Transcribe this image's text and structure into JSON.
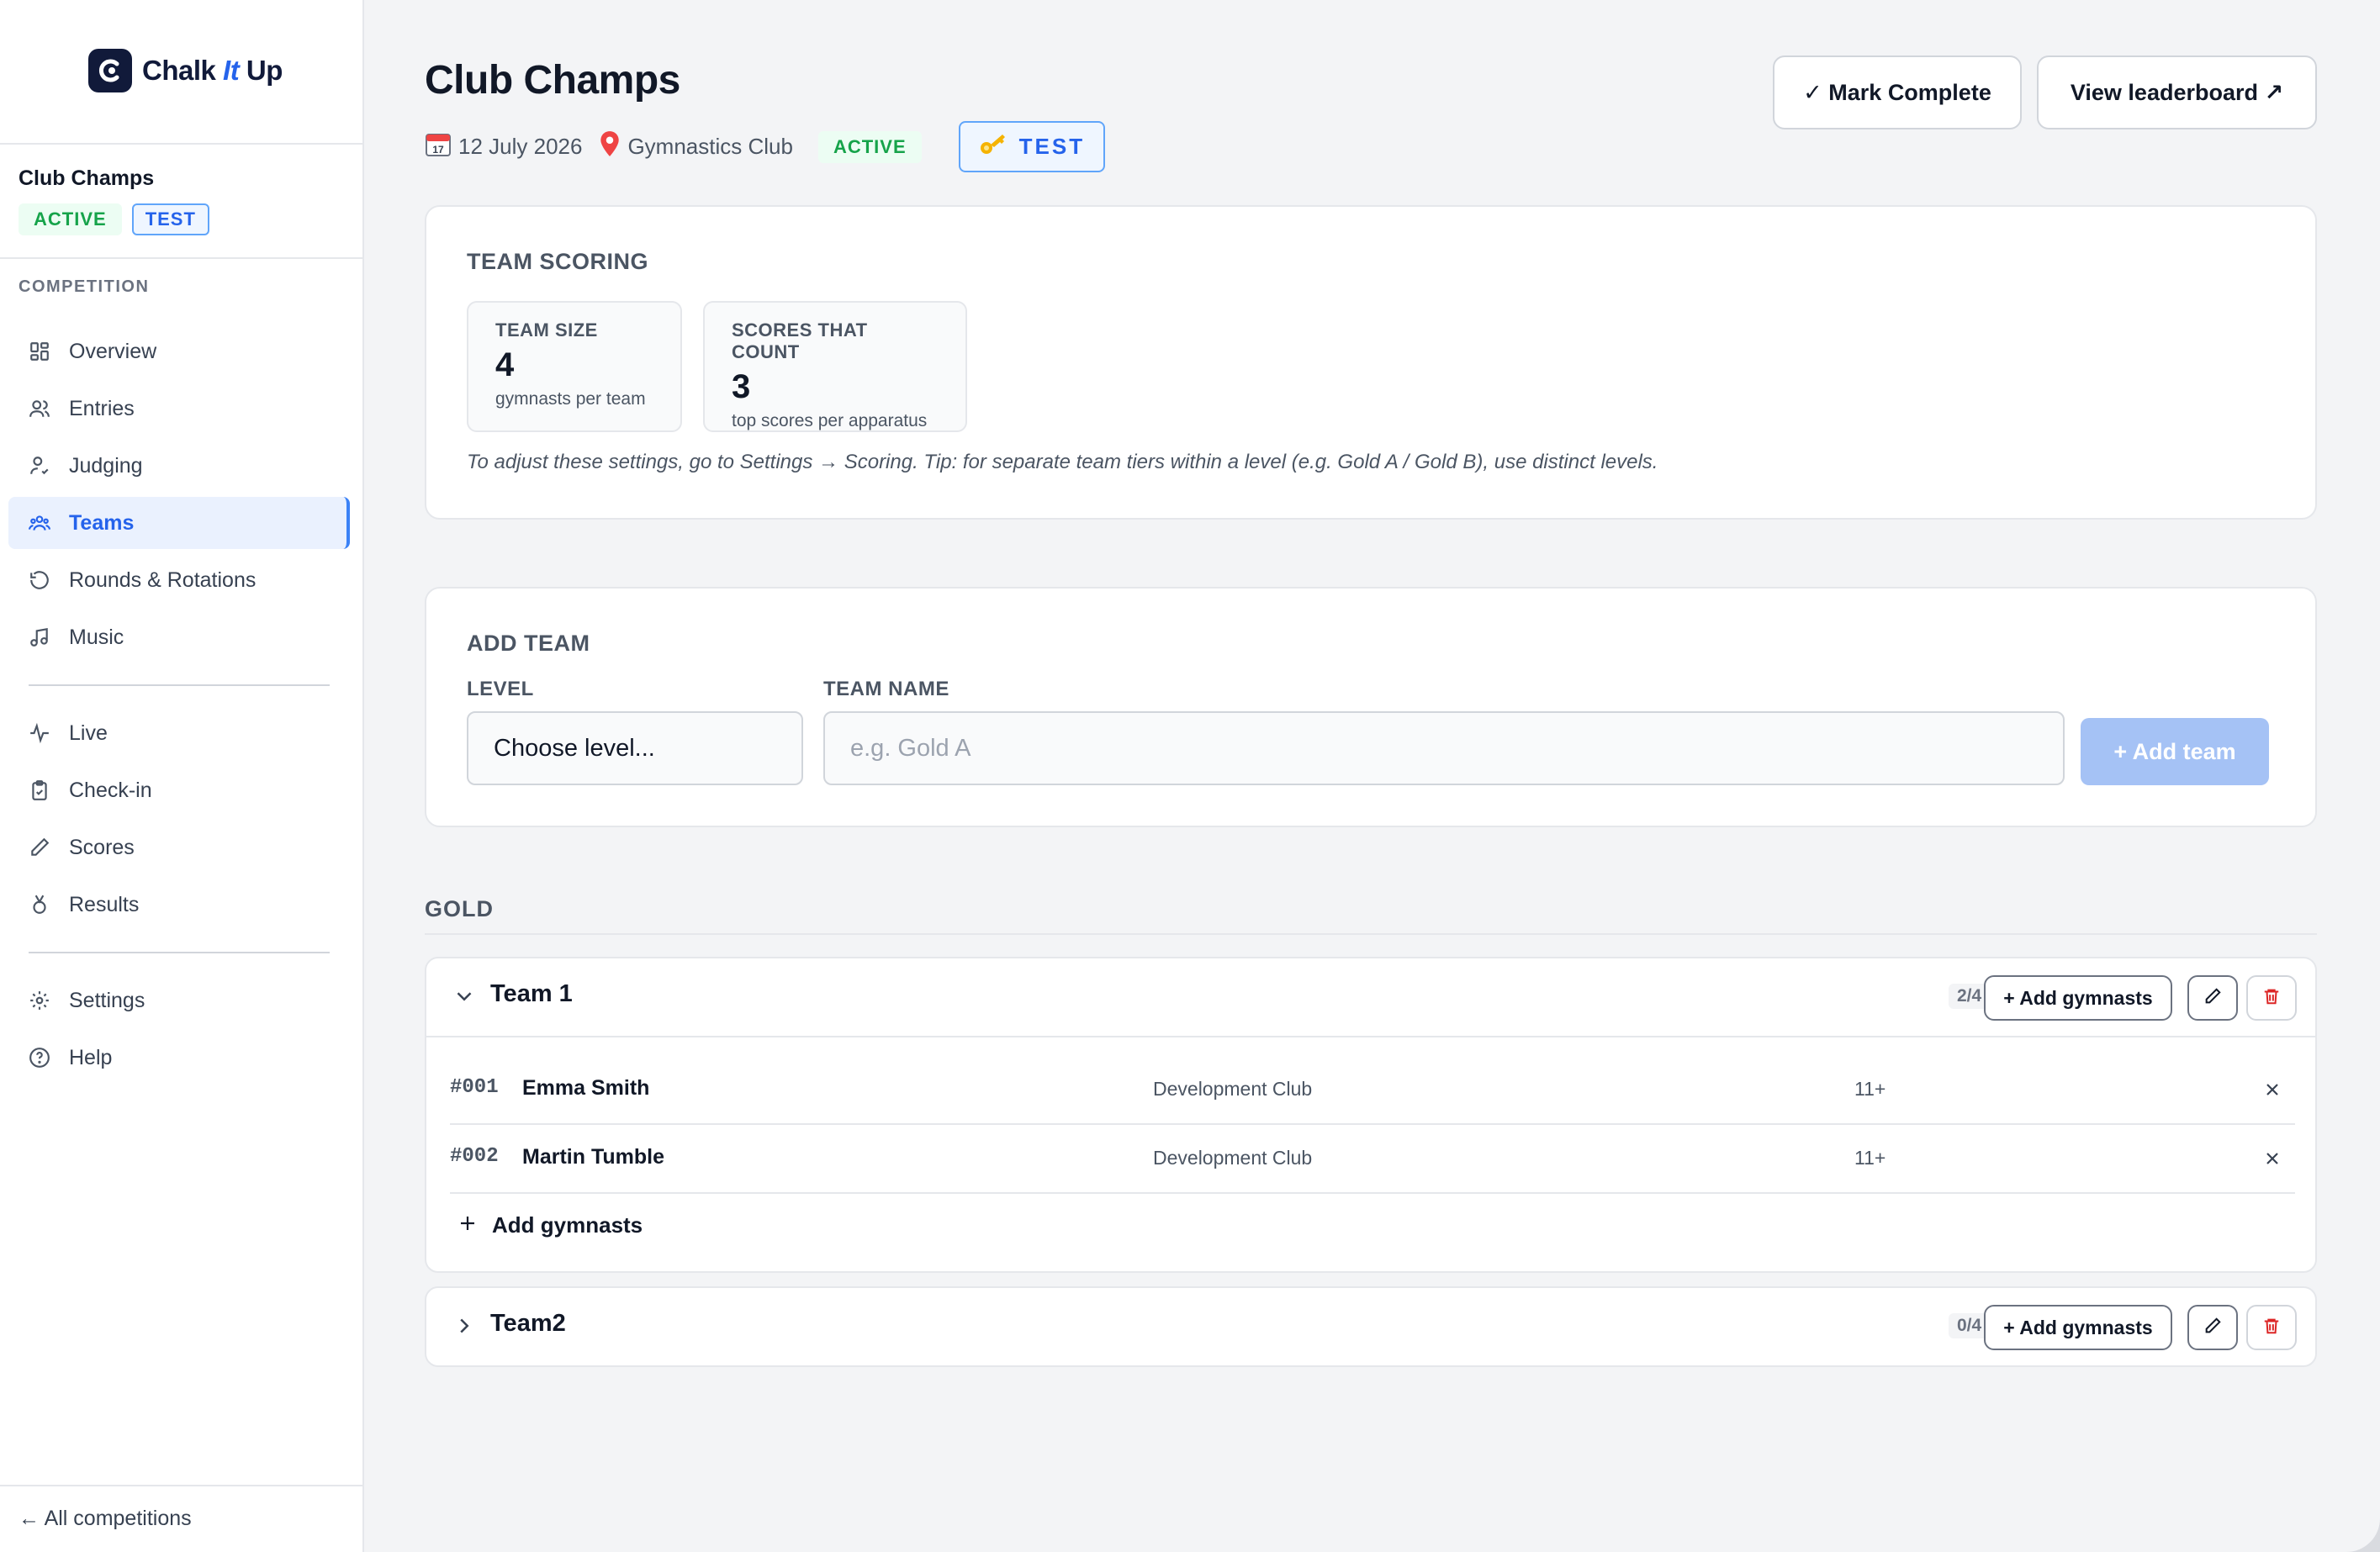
{
  "brand": {
    "name_left": "Chalk",
    "name_it": "It",
    "name_right": "Up"
  },
  "sidebar": {
    "competition_title": "Club Champs",
    "badge_active": "ACTIVE",
    "badge_test": "TEST",
    "section_label": "COMPETITION",
    "items": [
      {
        "label": "Overview",
        "icon": "overview-grid-icon"
      },
      {
        "label": "Entries",
        "icon": "users-icon"
      },
      {
        "label": "Judging",
        "icon": "judge-icon"
      },
      {
        "label": "Teams",
        "icon": "team-icon",
        "active": true
      },
      {
        "label": "Rounds & Rotations",
        "icon": "rotate-icon"
      },
      {
        "label": "Music",
        "icon": "music-icon"
      },
      {
        "label": "Live",
        "icon": "pulse-icon"
      },
      {
        "label": "Check-in",
        "icon": "clipboard-check-icon"
      },
      {
        "label": "Scores",
        "icon": "pencil-icon"
      },
      {
        "label": "Results",
        "icon": "medal-icon"
      },
      {
        "label": "Settings",
        "icon": "gear-icon"
      },
      {
        "label": "Help",
        "icon": "help-icon"
      }
    ],
    "back_link": "← All competitions"
  },
  "header": {
    "title": "Club Champs",
    "date": "12 July 2026",
    "venue": "Gymnastics Club",
    "badge_active": "ACTIVE",
    "badge_test": "TEST",
    "mark_complete": "✓ Mark Complete",
    "view_leaderboard": "View leaderboard ↗"
  },
  "team_scoring": {
    "title": "TEAM SCORING",
    "team_size_label": "TEAM SIZE",
    "team_size_value": "4",
    "team_size_sub": "gymnasts per team",
    "scores_count_label": "SCORES THAT COUNT",
    "scores_count_value": "3",
    "scores_count_sub": "top scores per apparatus",
    "hint": "To adjust these settings, go to Settings → Scoring. Tip: for separate team tiers within a level (e.g. Gold A / Gold B), use distinct levels."
  },
  "add_team": {
    "title": "ADD TEAM",
    "level_label": "LEVEL",
    "level_value": "Choose level...",
    "name_label": "TEAM NAME",
    "name_placeholder": "e.g. Gold A",
    "button": "+ Add team"
  },
  "group": {
    "label": "GOLD",
    "teams": [
      {
        "name": "Team 1",
        "count": "2/4",
        "add_button": "+ Add gymnasts",
        "expanded": true,
        "gymnasts": [
          {
            "num": "#001",
            "name": "Emma Smith",
            "club": "Development Club",
            "age": "11+"
          },
          {
            "num": "#002",
            "name": "Martin Tumble",
            "club": "Development Club",
            "age": "11+"
          }
        ],
        "add_link": "Add gymnasts"
      },
      {
        "name": "Team2",
        "count": "0/4",
        "add_button": "+ Add gymnasts",
        "expanded": false
      }
    ]
  },
  "colors": {
    "accent": "#2563eb",
    "active_green": "#16a34a",
    "danger": "#dc2626",
    "brand_navy": "#111a3a"
  }
}
